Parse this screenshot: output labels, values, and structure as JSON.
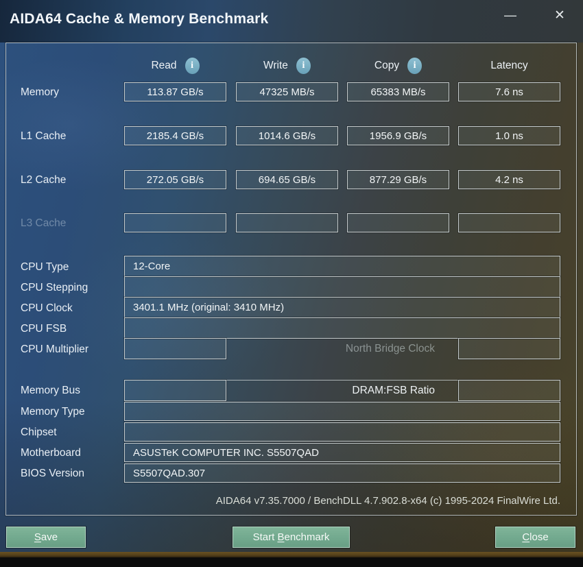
{
  "window": {
    "title": "AIDA64 Cache & Memory Benchmark",
    "minimize_glyph": "—",
    "close_glyph": "✕"
  },
  "benchmark": {
    "columns": [
      "Read",
      "Write",
      "Copy",
      "Latency"
    ],
    "info_icon_glyph": "i",
    "rows": [
      {
        "label": "Memory",
        "read": "113.87 GB/s",
        "write": "47325 MB/s",
        "copy": "65383 MB/s",
        "latency": "7.6 ns"
      },
      {
        "label": "L1 Cache",
        "read": "2185.4 GB/s",
        "write": "1014.6 GB/s",
        "copy": "1956.9 GB/s",
        "latency": "1.0 ns"
      },
      {
        "label": "L2 Cache",
        "read": "272.05 GB/s",
        "write": "694.65 GB/s",
        "copy": "877.29 GB/s",
        "latency": "4.2 ns"
      },
      {
        "label": "L3 Cache",
        "read": "",
        "write": "",
        "copy": "",
        "latency": ""
      }
    ]
  },
  "cpu": {
    "type_label": "CPU Type",
    "type_value": "12-Core",
    "stepping_label": "CPU Stepping",
    "stepping_value": "",
    "clock_label": "CPU Clock",
    "clock_value": "3401.1 MHz  (original: 3410 MHz)",
    "fsb_label": "CPU FSB",
    "fsb_value": "",
    "multiplier_label": "CPU Multiplier",
    "multiplier_value": "",
    "north_bridge_label": "North Bridge Clock",
    "north_bridge_value": ""
  },
  "memory": {
    "bus_label": "Memory Bus",
    "bus_value": "",
    "dram_fsb_label": "DRAM:FSB Ratio",
    "dram_fsb_value": "",
    "type_label": "Memory Type",
    "type_value": "",
    "chipset_label": "Chipset",
    "chipset_value": "",
    "motherboard_label": "Motherboard",
    "motherboard_value": "ASUSTeK COMPUTER INC. S5507QAD",
    "bios_label": "BIOS Version",
    "bios_value": "S5507QAD.307"
  },
  "footer": {
    "credits": "AIDA64 v7.35.7000 / BenchDLL 4.7.902.8-x64  (c) 1995-2024 FinalWire Ltd."
  },
  "buttons": {
    "save": {
      "pre": "",
      "key": "S",
      "post": "ave"
    },
    "start": {
      "pre": "Start ",
      "key": "B",
      "post": "enchmark"
    },
    "close": {
      "pre": "",
      "key": "C",
      "post": "lose"
    }
  },
  "colors": {
    "button_green": "#72a98e",
    "info_icon_blue": "#7db4c7",
    "titlebar_blue": "#2b486a",
    "background_blue": "#2d517e",
    "background_olive": "#4a4429"
  }
}
